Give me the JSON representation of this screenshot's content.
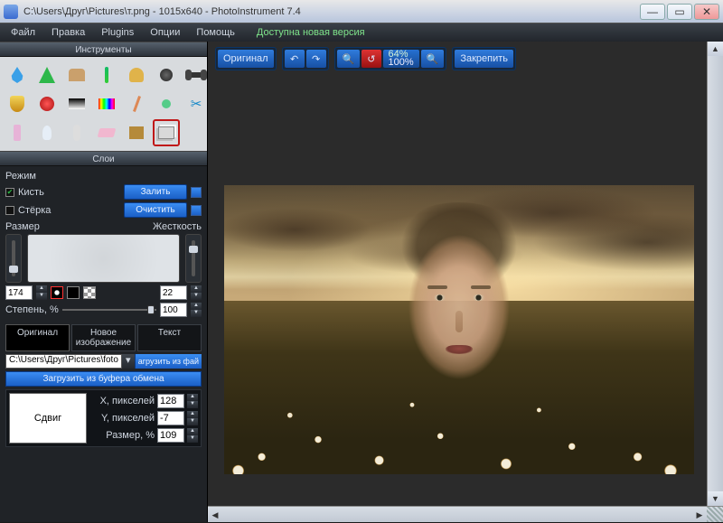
{
  "window": {
    "title": "C:\\Users\\Друг\\Pictures\\т.png  -  1015x640  -  PhotoInstrument 7.4"
  },
  "menu": {
    "file": "Файл",
    "edit": "Правка",
    "plugins": "Plugins",
    "options": "Опции",
    "help": "Помощь",
    "new_version": "Доступна новая версия"
  },
  "canvas_toolbar": {
    "original": "Оригинал",
    "zoom_a": "64%",
    "zoom_b": "100%",
    "pin": "Закрепить"
  },
  "panels": {
    "tools_title": "Инструменты",
    "layers_title": "Слои"
  },
  "tools": [
    "drop-tool",
    "cone-tool",
    "hand-tool",
    "brush-tool",
    "stamp-tool",
    "dot-tool",
    "dumbbell-tool",
    "shield-tool",
    "redcircle-tool",
    "grayscale-tool",
    "hue-tool",
    "pencil-tool",
    "denoise-tool",
    "scissors-tool",
    "bottle-tool",
    "bulb-tool",
    "spiral-tool",
    "eraser-tool",
    "box-tool",
    "layers-tool"
  ],
  "mode": {
    "label": "Режим",
    "brush": "Кисть",
    "eraser": "Стёрка",
    "fill": "Залить",
    "clear": "Очистить"
  },
  "sliders": {
    "size_label": "Размер",
    "size_value": "174",
    "hardness_label": "Жесткость",
    "hardness_value": "22",
    "degree_label": "Степень, %",
    "degree_value": "100"
  },
  "tabs": {
    "original": "Оригинал",
    "newimage": "Новое изображение",
    "text": "Текст"
  },
  "load": {
    "path": "C:\\Users\\Друг\\Pictures\\foto na",
    "load_from_file": "агрузить из фай",
    "load_from_clipboard": "Загрузить из буфера обмена"
  },
  "offset": {
    "thumb_label": "Сдвиг",
    "x_label": "X, пикселей",
    "x_value": "128",
    "y_label": "Y, пикселей",
    "y_value": "-7",
    "size_label": "Размер, %",
    "size_value": "109"
  },
  "colors": {
    "sel_ring": "#ff3030",
    "sel_fg": "#000000"
  }
}
